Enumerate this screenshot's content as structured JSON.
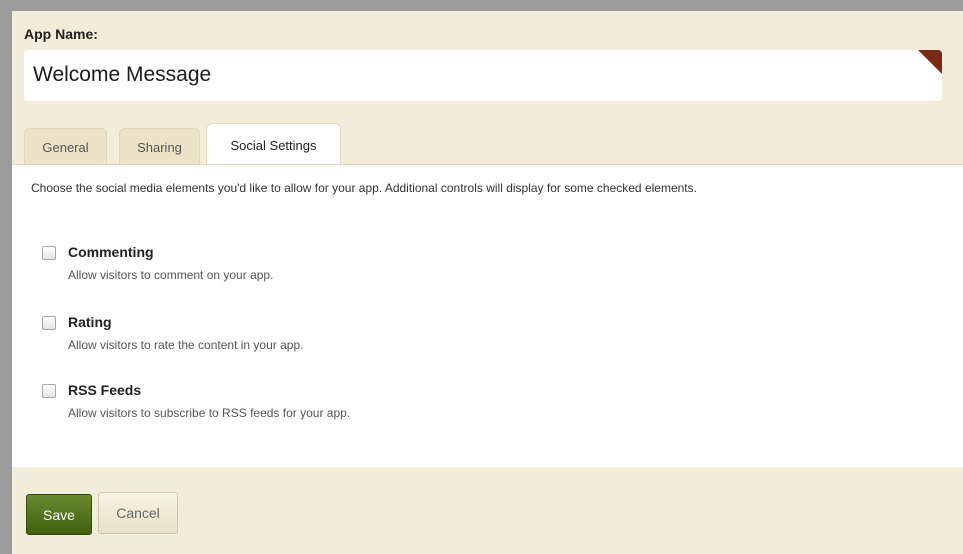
{
  "app": {
    "name_label": "App Name:",
    "name_value": "Welcome Message"
  },
  "tabs": [
    {
      "label": "General",
      "active": false
    },
    {
      "label": "Sharing",
      "active": false
    },
    {
      "label": "Social Settings",
      "active": true
    }
  ],
  "intro_text": "Choose the social media elements you'd like to allow for your app. Additional controls will display for some checked elements.",
  "options": [
    {
      "title": "Commenting",
      "description": "Allow visitors to comment on your app.",
      "checked": false
    },
    {
      "title": "Rating",
      "description": "Allow visitors to rate the content in your app.",
      "checked": false
    },
    {
      "title": "RSS Feeds",
      "description": "Allow visitors to subscribe to RSS feeds for your app.",
      "checked": false
    }
  ],
  "buttons": {
    "save_label": "Save",
    "cancel_label": "Cancel"
  },
  "colors": {
    "panel_bg": "#f2ecda",
    "save_green": "#4f7119",
    "corner_flag": "#7a2a14"
  }
}
